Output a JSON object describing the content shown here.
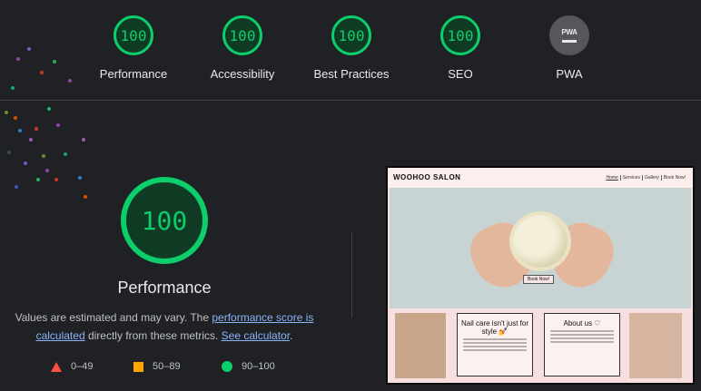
{
  "categories": [
    {
      "label": "Performance",
      "score": "100"
    },
    {
      "label": "Accessibility",
      "score": "100"
    },
    {
      "label": "Best Practices",
      "score": "100"
    },
    {
      "label": "SEO",
      "score": "100"
    },
    {
      "label": "PWA",
      "badge": "PWA"
    }
  ],
  "main": {
    "score": "100",
    "title": "Performance",
    "desc_pre": "Values are estimated and may vary. The ",
    "desc_link1": "performance score is calculated",
    "desc_mid": " directly from these metrics. ",
    "desc_link2": "See calculator",
    "desc_post": "."
  },
  "legend": {
    "fail": "0–49",
    "average": "50–89",
    "pass": "90–100"
  },
  "colors": {
    "pass": "#0cce6b",
    "average": "#ffa400",
    "fail": "#ff4e42",
    "link": "#8ab4f8",
    "background": "#202124"
  },
  "screenshot": {
    "brand": "WOOHOO SALON",
    "nav": [
      "Home",
      "Services",
      "Gallery",
      "Book Now!"
    ],
    "hero_button": "Book Now!",
    "card1_title": "Nail care isn't just for style 💅",
    "card2_title": "About us ♡"
  }
}
